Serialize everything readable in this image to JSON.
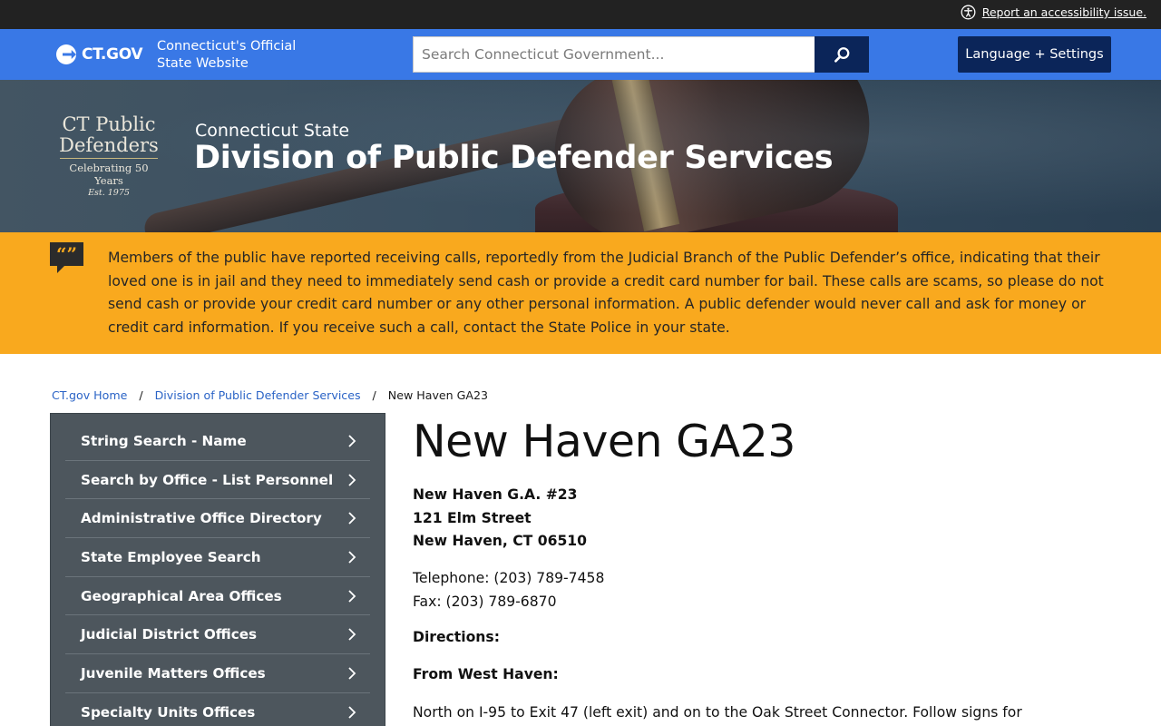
{
  "utility": {
    "accessibility_link": "Report an accessibility issue."
  },
  "header": {
    "logo_text": "CT.GOV",
    "tagline_line1": "Connecticut's Official",
    "tagline_line2": "State Website",
    "search_placeholder": "Search Connecticut Government...",
    "language_button": "Language + Settings"
  },
  "hero": {
    "logo_line1": "CT Public",
    "logo_line2": "Defenders",
    "logo_line3": "Celebrating 50 Years",
    "logo_line4": "Est. 1975",
    "subtitle": "Connecticut State",
    "title": "Division of Public Defender Services"
  },
  "alert": {
    "text": "Members of the public have reported receiving calls, reportedly from the Judicial Branch of the Public Defender’s office, indicating that their loved one is in jail and they need to immediately send cash or provide a credit card number for bail. These calls are scams, so please do not send cash or provide your credit card number or any other personal information. A public defender would never call and ask for money or credit card information. If you receive such a call, contact the State Police in your state."
  },
  "breadcrumb": {
    "home": "CT.gov Home",
    "division": "Division of Public Defender Services",
    "current": "New Haven GA23"
  },
  "sidebar": {
    "items": [
      {
        "label": "String Search - Name"
      },
      {
        "label": "Search by Office - List Personnel"
      },
      {
        "label": "Administrative Office Directory"
      },
      {
        "label": "State Employee Search"
      },
      {
        "label": "Geographical Area Offices"
      },
      {
        "label": "Judicial District Offices"
      },
      {
        "label": "Juvenile Matters Offices"
      },
      {
        "label": "Specialty Units Offices"
      }
    ]
  },
  "main": {
    "title": "New Haven GA23",
    "address_line1": "New Haven G.A. #23",
    "address_line2": "121 Elm Street",
    "address_line3": "New Haven, CT 06510",
    "telephone": "Telephone: (203) 789-7458",
    "fax": "Fax: (203) 789-6870",
    "directions_heading": "Directions:",
    "from_heading": "From West Haven:",
    "from_text": "North on I-95 to Exit 47 (left exit) and on to the Oak Street Connector. Follow signs for"
  },
  "colors": {
    "utility_bar": "#222222",
    "header_blue": "#3978e6",
    "navy": "#0b2559",
    "alert": "#f9a91e",
    "sidebar": "#4d565d",
    "link": "#2a63c6"
  },
  "icons": {
    "accessibility": "accessibility-icon",
    "search": "search-icon",
    "alert": "quote-bubble-icon",
    "chevron": "chevron-right-icon"
  }
}
